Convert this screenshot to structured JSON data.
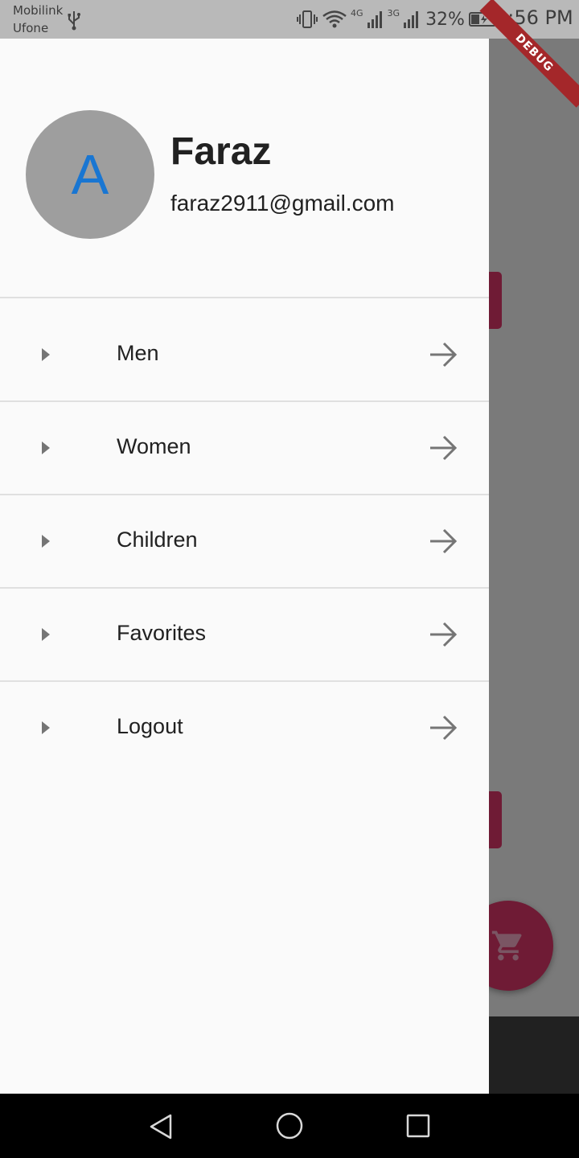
{
  "status_bar": {
    "carrier_primary": "Mobilink",
    "carrier_secondary": "Ufone",
    "network_1": "4G",
    "network_2": "3G",
    "battery_percent": "32%",
    "time": "3:56 PM",
    "icons": [
      "usb-icon",
      "vibrate-icon",
      "wifi-icon",
      "signal-icon",
      "signal-icon",
      "battery-charging-icon"
    ]
  },
  "debug_banner": "DEBUG",
  "drawer": {
    "avatar_letter": "A",
    "user_name": "Faraz",
    "user_email": "faraz2911@gmail.com",
    "menu": [
      {
        "label": "Men",
        "leading_icon": "caret-right-icon",
        "trailing_icon": "arrow-forward-icon"
      },
      {
        "label": "Women",
        "leading_icon": "caret-right-icon",
        "trailing_icon": "arrow-forward-icon"
      },
      {
        "label": "Children",
        "leading_icon": "caret-right-icon",
        "trailing_icon": "arrow-forward-icon"
      },
      {
        "label": "Favorites",
        "leading_icon": "caret-right-icon",
        "trailing_icon": "arrow-forward-icon"
      },
      {
        "label": "Logout",
        "leading_icon": "caret-right-icon",
        "trailing_icon": "arrow-forward-icon"
      }
    ]
  },
  "background_app": {
    "fab_icon": "shopping-cart-icon"
  },
  "nav_bar": {
    "icons": [
      "back-icon",
      "home-icon",
      "recents-icon"
    ]
  },
  "colors": {
    "avatar_bg": "#9e9e9e",
    "avatar_letter": "#1976d2",
    "drawer_bg": "#fafafa",
    "accent_dimmed": "#6f1b35",
    "debug_ribbon": "#a4272a"
  }
}
